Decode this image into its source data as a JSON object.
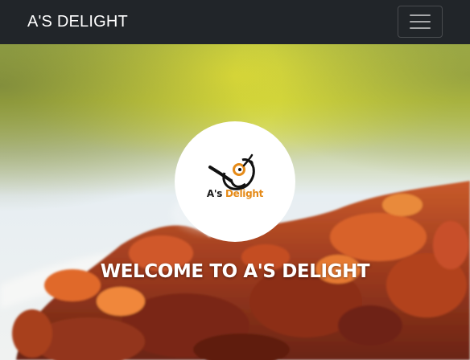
{
  "navbar": {
    "brand": "A'S DELIGHT",
    "toggle_icon": "hamburger-menu-icon",
    "background_color": "#212529"
  },
  "hero": {
    "logo": {
      "text_part_1": "A's ",
      "text_part_2": "Delight",
      "accent_color": "#e58a17"
    },
    "welcome_text": "WELCOME TO A'S DELIGHT"
  }
}
